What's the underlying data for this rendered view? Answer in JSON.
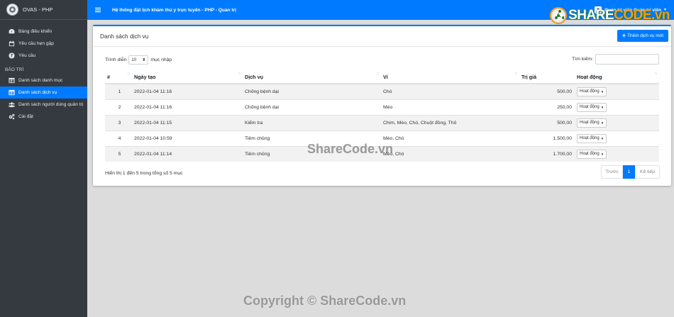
{
  "brand": {
    "name": "OVAS - PHP"
  },
  "topbar": {
    "title": "Hệ thống đặt lịch khám thú y trực tuyến - PHP - Quản trị",
    "user": "Quản trị viên Quản trị viên"
  },
  "sidebar": {
    "items": [
      {
        "label": "Bảng điều khiển",
        "icon": "dashboard-icon"
      },
      {
        "label": "Yêu cầu hẹn gặp",
        "icon": "calendar-icon"
      },
      {
        "label": "Yêu cầu",
        "icon": "question-icon"
      }
    ],
    "section": "BẢO TRÌ",
    "maintenance": [
      {
        "label": "Danh sách danh mục",
        "icon": "table-icon"
      },
      {
        "label": "Danh sách dịch vụ",
        "icon": "table-icon",
        "active": true
      },
      {
        "label": "Danh sách người dùng quản trị",
        "icon": "users-icon"
      },
      {
        "label": "Cài đặt",
        "icon": "cogs-icon"
      }
    ]
  },
  "card": {
    "title": "Danh sách dịch vụ",
    "add_label": "Thêm dịch vụ mới",
    "length_prefix": "Trình diễn",
    "length_value": "10",
    "length_suffix": "mục nhập",
    "search_label": "Tìm kiếm:",
    "search_value": ""
  },
  "table": {
    "headers": [
      "#",
      "Ngày tạo",
      "Dịch vụ",
      "Ví",
      "Trị giá",
      "Hoạt động"
    ],
    "rows": [
      {
        "no": "1",
        "date": "2022-01-04 11:16",
        "service": "Chống bệnh dại",
        "species": "Chó",
        "price": "500,00",
        "action": "Hoạt động"
      },
      {
        "no": "2",
        "date": "2022-01-04 11:16",
        "service": "Chống bệnh dại",
        "species": "Mèo",
        "price": "250,00",
        "action": "Hoạt động"
      },
      {
        "no": "3",
        "date": "2022-01-04 11:15",
        "service": "Kiểm tra",
        "species": "Chim, Mèo, Chó, Chuột đồng, Thỏ",
        "price": "500,00",
        "action": "Hoạt động"
      },
      {
        "no": "4",
        "date": "2022-01-04 10:59",
        "service": "Tiêm chủng",
        "species": "Mèo, Chó",
        "price": "1.500,00",
        "action": "Hoạt động"
      },
      {
        "no": "5",
        "date": "2022-01-04 11:14",
        "service": "Tiêm chủng",
        "species": "Mèo, Chó",
        "price": "1.700,00",
        "action": "Hoạt động"
      }
    ]
  },
  "footer": {
    "info": "Hiển thị 1 đến 5 trong tổng số 5 mục",
    "prev": "Trước",
    "page": "1",
    "next": "Kế tiếp"
  },
  "watermarks": {
    "logo_left": "SHARE",
    "logo_right": "CODE",
    "logo_tld": ".vn",
    "middle": "ShareCode.vn",
    "bottom": "Copyright © ShareCode.vn"
  },
  "colors": {
    "primary": "#007bff",
    "sidebar": "#343a40",
    "logo_accent": "#f39a1b"
  }
}
